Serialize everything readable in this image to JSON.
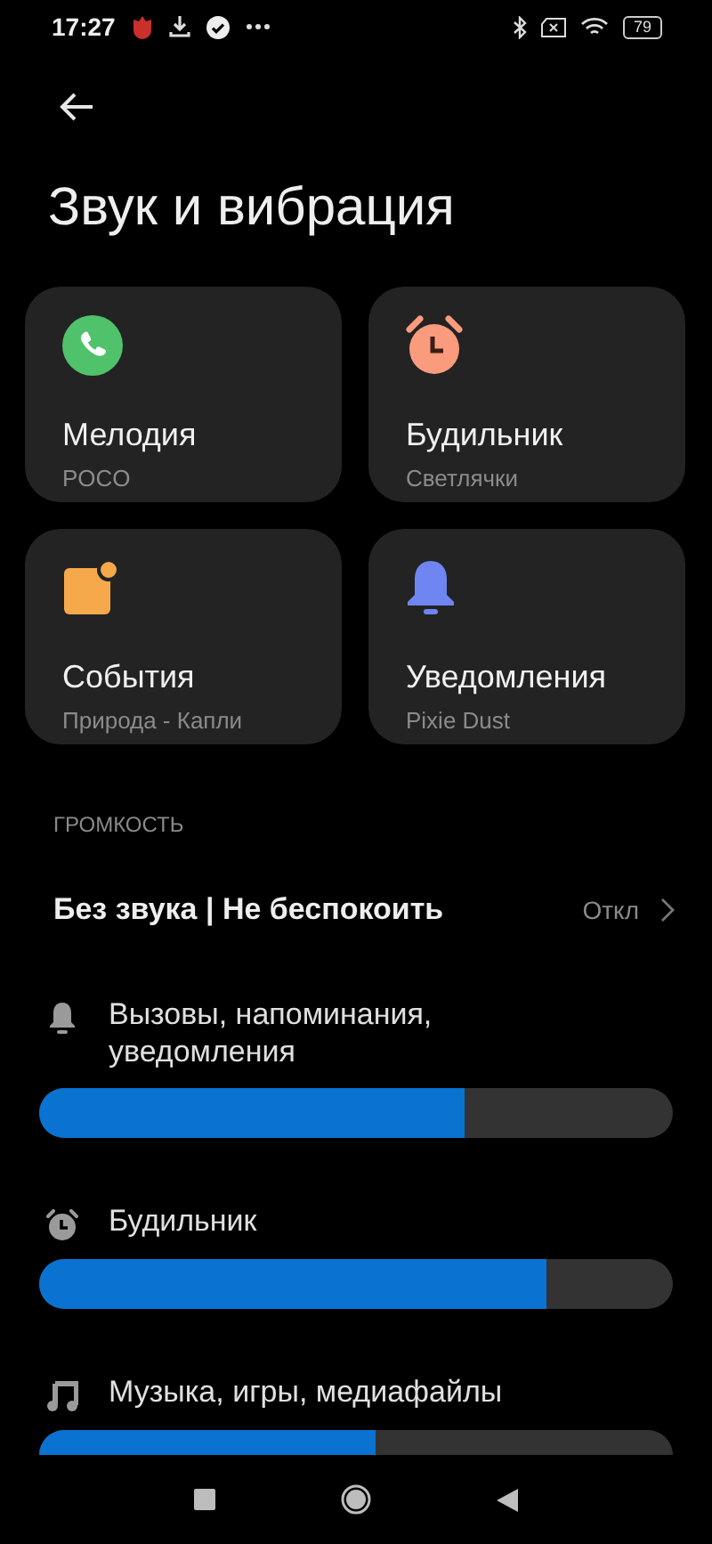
{
  "status_bar": {
    "time": "17:27",
    "battery": "79"
  },
  "title": "Звук и вибрация",
  "cards": [
    {
      "title": "Мелодия",
      "subtitle": "POCO"
    },
    {
      "title": "Будильник",
      "subtitle": "Светлячки"
    },
    {
      "title": "События",
      "subtitle": "Природа - Капли"
    },
    {
      "title": "Уведомления",
      "subtitle": "Pixie Dust"
    }
  ],
  "section_header": "ГРОМКОСТЬ",
  "dnd_row": {
    "label": "Без звука | Не беспокоить",
    "value": "Откл"
  },
  "volume_sliders": [
    {
      "label": "Вызовы, напоминания, уведомления",
      "level": 0.67
    },
    {
      "label": "Будильник",
      "level": 0.8
    },
    {
      "label": "Музыка, игры, медиафайлы",
      "level": 0.53
    }
  ]
}
